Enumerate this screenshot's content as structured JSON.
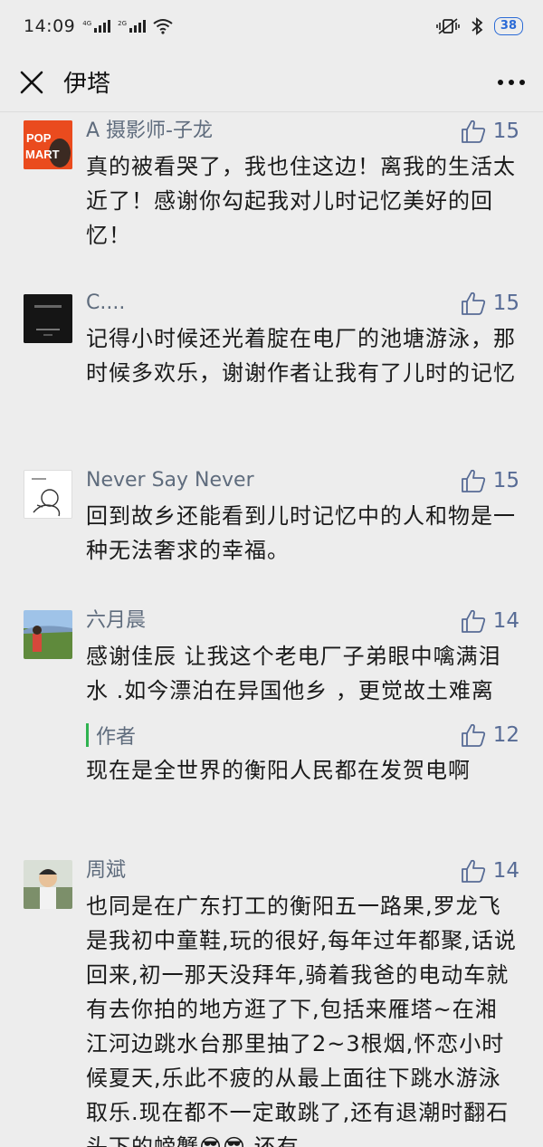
{
  "status_bar": {
    "time": "14:09",
    "network_1": "4G",
    "network_2": "2G",
    "battery": "38"
  },
  "nav": {
    "title": "伊塔"
  },
  "comments": [
    {
      "author": "A 摄影师-子龙",
      "likes": "15",
      "content": "真的被看哭了，我也住这边！离我的生活太近了！感谢你勾起我对儿时记忆美好的回忆！",
      "avatar_text": "POP MART"
    },
    {
      "author": "C....",
      "likes": "15",
      "content": "记得小时候还光着腚在电厂的池塘游泳，那时候多欢乐，谢谢作者让我有了儿时的记忆"
    },
    {
      "author": "Never Say Never",
      "likes": "15",
      "content": "回到故乡还能看到儿时记忆中的人和物是一种无法奢求的幸福。"
    },
    {
      "author": "六月晨",
      "likes": "14",
      "content": "感谢佳辰 让我这个老电厂子弟眼中噙满泪水 .如今漂泊在异国他乡 ，更觉故土难离",
      "reply": {
        "author": "作者",
        "likes": "12",
        "content": "现在是全世界的衡阳人民都在发贺电啊"
      }
    },
    {
      "author": "周斌",
      "likes": "14",
      "content": "也同是在广东打工的衡阳五一路果,罗龙飞是我初中童鞋,玩的很好,每年过年都聚,话说回来,初一那天没拜年,骑着我爸的电动车就有去你拍的地方逛了下,包括来雁塔~在湘江河边跳水台那里抽了2~3根烟,怀恋小时候夏天,乐此不疲的从最上面往下跳水游泳取乐.现在都不一定敢跳了,还有退潮时翻石头下的螃蟹😎😎,还有"
    }
  ]
}
